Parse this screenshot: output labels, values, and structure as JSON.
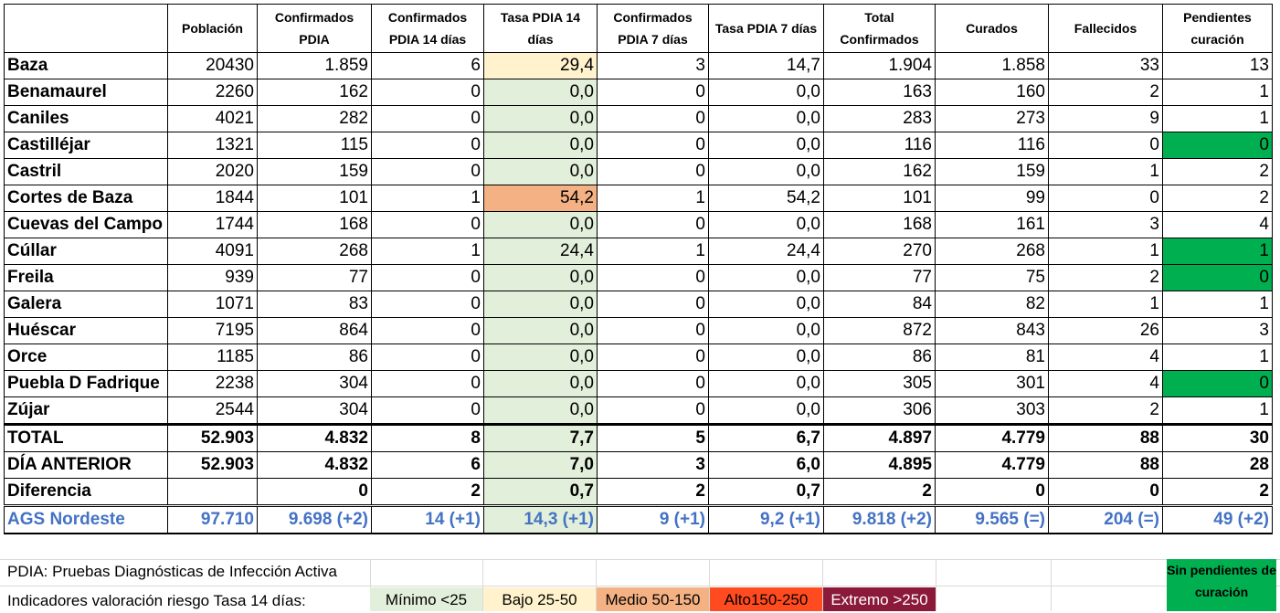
{
  "table": {
    "headers": [
      "",
      "Población",
      "Confirmados PDIA",
      "Confirmados PDIA 14 días",
      "Tasa PDIA 14 días",
      "Confirmados PDIA 7 días",
      "Tasa PDIA 7 días",
      "Total Confirmados",
      "Curados",
      "Fallecidos",
      "Pendientes curación"
    ],
    "rows": [
      {
        "name": "Baza",
        "v": [
          "20430",
          "1.859",
          "6",
          "29,4",
          "3",
          "14,7",
          "1.904",
          "1.858",
          "33",
          "13"
        ],
        "tasa": "bajo",
        "pend": ""
      },
      {
        "name": "Benamaurel",
        "v": [
          "2260",
          "162",
          "0",
          "0,0",
          "0",
          "0,0",
          "163",
          "160",
          "2",
          "1"
        ],
        "tasa": "min",
        "pend": ""
      },
      {
        "name": "Caniles",
        "v": [
          "4021",
          "282",
          "0",
          "0,0",
          "0",
          "0,0",
          "283",
          "273",
          "9",
          "1"
        ],
        "tasa": "min",
        "pend": ""
      },
      {
        "name": "Castilléjar",
        "v": [
          "1321",
          "115",
          "0",
          "0,0",
          "0",
          "0,0",
          "116",
          "116",
          "0",
          "0"
        ],
        "tasa": "min",
        "pend": "green"
      },
      {
        "name": "Castril",
        "v": [
          "2020",
          "159",
          "0",
          "0,0",
          "0",
          "0,0",
          "162",
          "159",
          "1",
          "2"
        ],
        "tasa": "min",
        "pend": ""
      },
      {
        "name": "Cortes de Baza",
        "v": [
          "1844",
          "101",
          "1",
          "54,2",
          "1",
          "54,2",
          "101",
          "99",
          "0",
          "2"
        ],
        "tasa": "medio",
        "pend": ""
      },
      {
        "name": "Cuevas del Campo",
        "v": [
          "1744",
          "168",
          "0",
          "0,0",
          "0",
          "0,0",
          "168",
          "161",
          "3",
          "4"
        ],
        "tasa": "min",
        "pend": ""
      },
      {
        "name": "Cúllar",
        "v": [
          "4091",
          "268",
          "1",
          "24,4",
          "1",
          "24,4",
          "270",
          "268",
          "1",
          "1"
        ],
        "tasa": "min",
        "pend": "green"
      },
      {
        "name": "Freila",
        "v": [
          "939",
          "77",
          "0",
          "0,0",
          "0",
          "0,0",
          "77",
          "75",
          "2",
          "0"
        ],
        "tasa": "min",
        "pend": "green"
      },
      {
        "name": "Galera",
        "v": [
          "1071",
          "83",
          "0",
          "0,0",
          "0",
          "0,0",
          "84",
          "82",
          "1",
          "1"
        ],
        "tasa": "min",
        "pend": ""
      },
      {
        "name": "Huéscar",
        "v": [
          "7195",
          "864",
          "0",
          "0,0",
          "0",
          "0,0",
          "872",
          "843",
          "26",
          "3"
        ],
        "tasa": "min",
        "pend": ""
      },
      {
        "name": "Orce",
        "v": [
          "1185",
          "86",
          "0",
          "0,0",
          "0",
          "0,0",
          "86",
          "81",
          "4",
          "1"
        ],
        "tasa": "min",
        "pend": ""
      },
      {
        "name": "Puebla D Fadrique",
        "v": [
          "2238",
          "304",
          "0",
          "0,0",
          "0",
          "0,0",
          "305",
          "301",
          "4",
          "0"
        ],
        "tasa": "min",
        "pend": "green"
      },
      {
        "name": "Zújar",
        "v": [
          "2544",
          "304",
          "0",
          "0,0",
          "0",
          "0,0",
          "306",
          "303",
          "2",
          "1"
        ],
        "tasa": "min",
        "pend": ""
      }
    ],
    "total": {
      "name": "TOTAL",
      "v": [
        "52.903",
        "4.832",
        "8",
        "7,7",
        "5",
        "6,7",
        "4.897",
        "4.779",
        "88",
        "30"
      ]
    },
    "anterior": {
      "name": "DÍA ANTERIOR",
      "v": [
        "52.903",
        "4.832",
        "6",
        "7,0",
        "3",
        "6,0",
        "4.895",
        "4.779",
        "88",
        "28"
      ]
    },
    "diferencia": {
      "name": "Diferencia",
      "v": [
        "",
        "0",
        "2",
        "0,7",
        "2",
        "0,7",
        "2",
        "0",
        "0",
        "2"
      ]
    },
    "ags": {
      "name": "AGS Nordeste",
      "v": [
        "97.710",
        "9.698 (+2)",
        "14 (+1)",
        "14,3 (+1)",
        "9 (+1)",
        "9,2 (+1)",
        "9.818 (+2)",
        "9.565 (=)",
        "204 (=)",
        "49 (+2)"
      ]
    }
  },
  "legend": {
    "pdia_note": "PDIA: Pruebas Diagnósticas de Infección Activa",
    "indicators_label": "Indicadores valoración riesgo Tasa 14 días:",
    "levels": [
      {
        "label": "Mínimo <25",
        "color": "#e2efda",
        "text_color": "#000000"
      },
      {
        "label": "Bajo 25-50",
        "color": "#fff2cc",
        "text_color": "#000000"
      },
      {
        "label": "Medio 50-150",
        "color": "#f4b183",
        "text_color": "#000000"
      },
      {
        "label": "Alto150-250",
        "color": "#ff4b1f",
        "text_color": "#000000"
      },
      {
        "label": "Extremo >250",
        "color": "#8b1a3a",
        "text_color": "#ffffff"
      }
    ],
    "sin_pendientes": "Sin pendientes de curación"
  }
}
